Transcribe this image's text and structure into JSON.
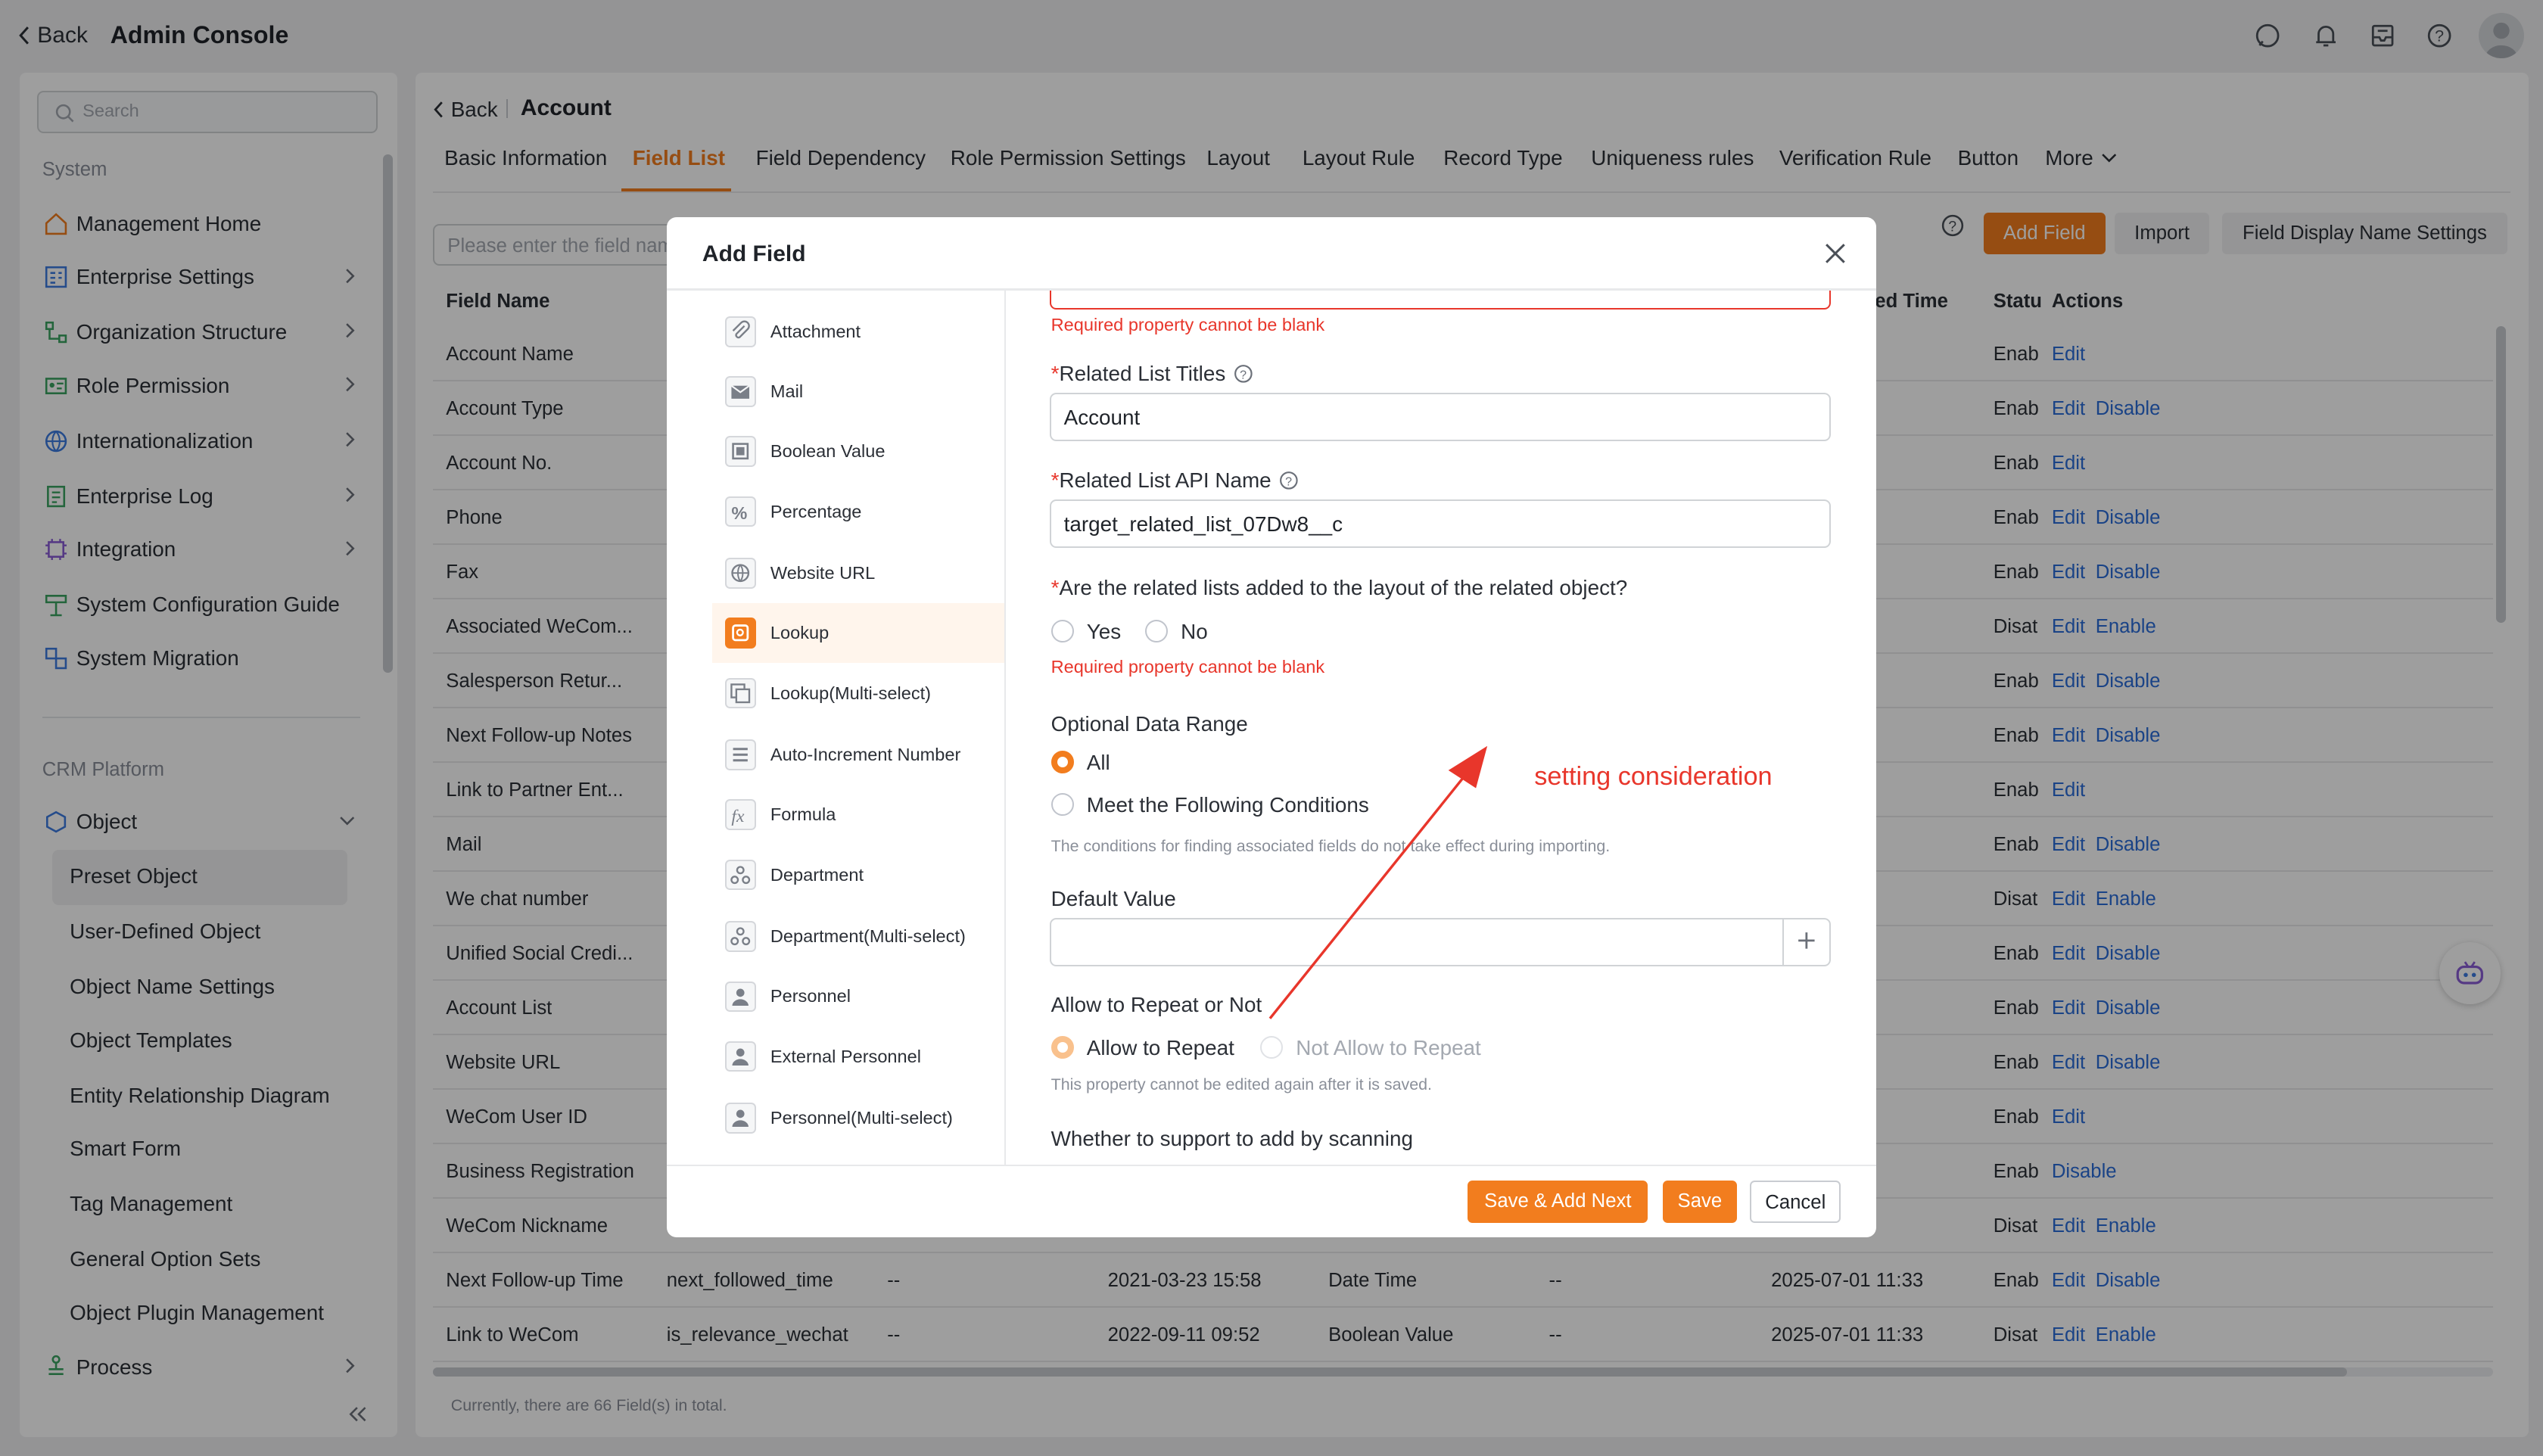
{
  "topbar": {
    "back_label": "Back",
    "title": "Admin Console",
    "icons": [
      "chat-icon",
      "bell-icon",
      "inbox-icon",
      "help-icon",
      "avatar"
    ]
  },
  "sidebar": {
    "search_placeholder": "Search",
    "system_label": "System",
    "items": [
      {
        "label": "Management Home",
        "icon": "home-icon"
      },
      {
        "label": "Enterprise Settings",
        "icon": "enterprise-icon"
      },
      {
        "label": "Organization Structure",
        "icon": "org-icon"
      },
      {
        "label": "Role Permission",
        "icon": "role-icon"
      },
      {
        "label": "Internationalization",
        "icon": "globe-icon"
      },
      {
        "label": "Enterprise Log",
        "icon": "log-icon"
      },
      {
        "label": "Integration",
        "icon": "integration-icon"
      },
      {
        "label": "System Configuration Guide",
        "icon": "guide-icon"
      },
      {
        "label": "System Migration",
        "icon": "migration-icon"
      }
    ],
    "crm_label": "CRM Platform",
    "object_label": "Object",
    "sub_items": [
      "Preset Object",
      "User-Defined Object",
      "Object Name Settings",
      "Object Templates",
      "Entity Relationship Diagram",
      "Smart Form",
      "Tag Management",
      "General Option Sets",
      "Object Plugin Management"
    ],
    "process_label": "Process"
  },
  "main": {
    "back_label": "Back",
    "title": "Account",
    "tabs": [
      "Basic Information",
      "Field List",
      "Field Dependency",
      "Role Permission Settings",
      "Layout",
      "Layout Rule",
      "Record Type",
      "Uniqueness rules",
      "Verification Rule",
      "Button",
      "More"
    ],
    "active_tab": "Field List",
    "filter_placeholder": "Please enter the field name",
    "buttons": {
      "add_field": "Add Field",
      "import": "Import",
      "display_name_settings": "Field Display Name Settings"
    },
    "columns": {
      "field_name": "Field Name",
      "modified_time": "ed Time",
      "status": "Statu",
      "actions": "Actions"
    },
    "rows": [
      {
        "name": "Account Name",
        "api": "",
        "d1": "",
        "created": "",
        "type": "",
        "d2": "",
        "modified": "11:33",
        "status": "Enab",
        "actions": [
          "Edit"
        ]
      },
      {
        "name": "Account Type",
        "api": "",
        "d1": "",
        "created": "",
        "type": "",
        "d2": "",
        "modified": "11:33",
        "status": "Enab",
        "actions": [
          "Edit",
          "Disable"
        ]
      },
      {
        "name": "Account No.",
        "api": "",
        "d1": "",
        "created": "",
        "type": "",
        "d2": "",
        "modified": "11:33",
        "status": "Enab",
        "actions": [
          "Edit"
        ]
      },
      {
        "name": "Phone",
        "api": "",
        "d1": "",
        "created": "",
        "type": "",
        "d2": "",
        "modified": "11:33",
        "status": "Enab",
        "actions": [
          "Edit",
          "Disable"
        ]
      },
      {
        "name": "Fax",
        "api": "",
        "d1": "",
        "created": "",
        "type": "",
        "d2": "",
        "modified": "11:33",
        "status": "Enab",
        "actions": [
          "Edit",
          "Disable"
        ]
      },
      {
        "name": "Associated WeCom...",
        "api": "",
        "d1": "",
        "created": "",
        "type": "",
        "d2": "",
        "modified": "11:33",
        "status": "Disat",
        "actions": [
          "Edit",
          "Enable"
        ]
      },
      {
        "name": "Salesperson Retur...",
        "api": "",
        "d1": "",
        "created": "",
        "type": "",
        "d2": "",
        "modified": "11:33",
        "status": "Enab",
        "actions": [
          "Edit",
          "Disable"
        ]
      },
      {
        "name": "Next Follow-up Notes",
        "api": "",
        "d1": "",
        "created": "",
        "type": "",
        "d2": "",
        "modified": "11:33",
        "status": "Enab",
        "actions": [
          "Edit",
          "Disable"
        ]
      },
      {
        "name": "Link to Partner Ent...",
        "api": "",
        "d1": "",
        "created": "",
        "type": "",
        "d2": "",
        "modified": "11:33",
        "status": "Enab",
        "actions": [
          "Edit"
        ]
      },
      {
        "name": "Mail",
        "api": "",
        "d1": "",
        "created": "",
        "type": "",
        "d2": "",
        "modified": "11:33",
        "status": "Enab",
        "actions": [
          "Edit",
          "Disable"
        ]
      },
      {
        "name": "We chat number",
        "api": "",
        "d1": "",
        "created": "",
        "type": "",
        "d2": "",
        "modified": "11:33",
        "status": "Disat",
        "actions": [
          "Edit",
          "Enable"
        ]
      },
      {
        "name": "Unified Social Credi...",
        "api": "",
        "d1": "",
        "created": "",
        "type": "",
        "d2": "",
        "modified": "11:33",
        "status": "Enab",
        "actions": [
          "Edit",
          "Disable"
        ]
      },
      {
        "name": "Account List",
        "api": "",
        "d1": "",
        "created": "",
        "type": "",
        "d2": "",
        "modified": "11:33",
        "status": "Enab",
        "actions": [
          "Edit",
          "Disable"
        ]
      },
      {
        "name": "Website URL",
        "api": "",
        "d1": "",
        "created": "",
        "type": "",
        "d2": "",
        "modified": "11:33",
        "status": "Enab",
        "actions": [
          "Edit",
          "Disable"
        ]
      },
      {
        "name": "WeCom User ID",
        "api": "",
        "d1": "",
        "created": "",
        "type": "",
        "d2": "",
        "modified": "11:33",
        "status": "Enab",
        "actions": [
          "Edit"
        ]
      },
      {
        "name": "Business Registration",
        "api": "",
        "d1": "",
        "created": "",
        "type": "",
        "d2": "",
        "modified": "11:33",
        "status": "Enab",
        "actions": [
          "Disable"
        ]
      },
      {
        "name": "WeCom Nickname",
        "api": "",
        "d1": "",
        "created": "",
        "type": "",
        "d2": "",
        "modified": "11:33",
        "status": "Disat",
        "actions": [
          "Edit",
          "Enable"
        ]
      },
      {
        "name": "Next Follow-up Time",
        "api": "next_followed_time",
        "d1": "--",
        "created": "2021-03-23 15:58",
        "type": "Date Time",
        "d2": "--",
        "modified": "2025-07-01 11:33",
        "status": "Enab",
        "actions": [
          "Edit",
          "Disable"
        ]
      },
      {
        "name": "Link to WeCom",
        "api": "is_relevance_wechat",
        "d1": "--",
        "created": "2022-09-11 09:52",
        "type": "Boolean Value",
        "d2": "--",
        "modified": "2025-07-01 11:33",
        "status": "Disat",
        "actions": [
          "Edit",
          "Enable"
        ]
      }
    ],
    "footer": "Currently, there are 66 Field(s) in total."
  },
  "modal": {
    "title": "Add Field",
    "field_types": [
      {
        "label": "Attachment",
        "icon": "attachment-icon"
      },
      {
        "label": "Mail",
        "icon": "mail-icon"
      },
      {
        "label": "Boolean Value",
        "icon": "boolean-icon"
      },
      {
        "label": "Percentage",
        "icon": "percent-icon"
      },
      {
        "label": "Website URL",
        "icon": "globe-icon"
      },
      {
        "label": "Lookup",
        "icon": "lookup-icon"
      },
      {
        "label": "Lookup(Multi-select)",
        "icon": "lookup-multi-icon"
      },
      {
        "label": "Auto-Increment Number",
        "icon": "list-icon"
      },
      {
        "label": "Formula",
        "icon": "formula-icon"
      },
      {
        "label": "Department",
        "icon": "department-icon"
      },
      {
        "label": "Department(Multi-select)",
        "icon": "department-multi-icon"
      },
      {
        "label": "Personnel",
        "icon": "person-icon"
      },
      {
        "label": "External Personnel",
        "icon": "external-person-icon"
      },
      {
        "label": "Personnel(Multi-select)",
        "icon": "person-multi-icon"
      }
    ],
    "selected_type": "Lookup",
    "err_top": "Required property cannot be blank",
    "related_titles_label": "Related List Titles",
    "related_titles_value": "Account",
    "api_name_label": "Related List API Name",
    "api_name_value": "target_related_list_07Dw8__c",
    "layout_question": "Are the related lists added to the layout of the related object?",
    "yes": "Yes",
    "no": "No",
    "err_layout": "Required property cannot be blank",
    "range_label": "Optional Data Range",
    "range_all": "All",
    "range_conditions": "Meet the Following Conditions",
    "range_hint": "The conditions for finding associated fields do not take effect during importing.",
    "default_label": "Default Value",
    "repeat_label": "Allow to Repeat or Not",
    "allow_repeat": "Allow to Repeat",
    "not_allow_repeat": "Not Allow to Repeat",
    "repeat_hint": "This property cannot be edited again after it is saved.",
    "scan_label": "Whether to support to add by scanning",
    "save_add_next": "Save & Add Next",
    "save": "Save",
    "cancel": "Cancel"
  },
  "annotation": {
    "text": "setting consideration",
    "color": "#e8362b"
  },
  "colors": {
    "accent": "#f27d1e",
    "link": "#2a6cd9",
    "error": "#e8362b"
  }
}
